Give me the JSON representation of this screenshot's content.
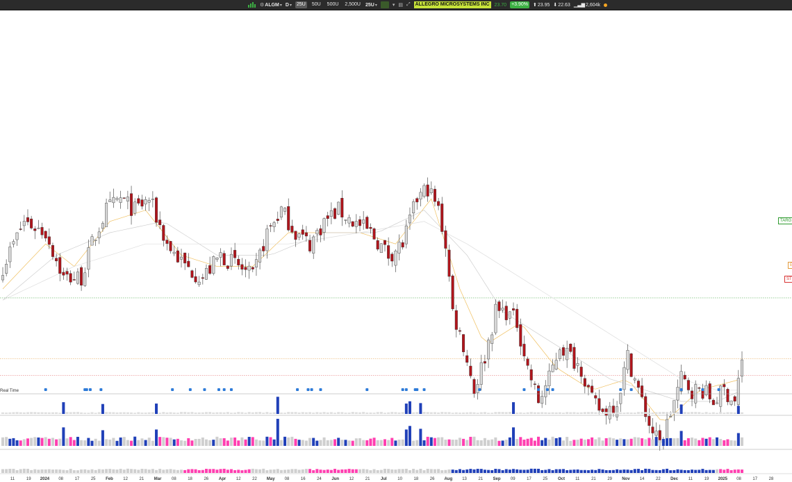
{
  "toolbar": {
    "symbol": "ALGM",
    "interval": "D",
    "bar_options": [
      "25U",
      "50U",
      "500U",
      "2,500U"
    ],
    "bar_selected": "25U",
    "bar_menu": "25U",
    "company": "ALLEGRO MICROSYSTEMS INC",
    "price": "23.70",
    "change": "+3.90%",
    "high": "23.95",
    "low": "22.63",
    "volume": "2,604k"
  },
  "labels": {
    "realtime": "Real Time",
    "target": "TARG",
    "entry": "E",
    "stop": "ST"
  },
  "colors": {
    "up_candle": "#d8d8d8",
    "down_candle": "#b0151c",
    "volume_blue": "#2040b8",
    "volume_pink": "#ff3fb0",
    "volume_gray": "#cfcfcf",
    "target_line": "#2e9a2e",
    "entry_line": "#e39a3b",
    "stop_line": "#d83333"
  },
  "chart_data": {
    "type": "candlestick",
    "price_levels": {
      "target": 29.2,
      "entry": 23.8,
      "stop": 22.3
    },
    "x_ticks": [
      "11",
      "19",
      "2024",
      "08",
      "17",
      "25",
      "Feb",
      "12",
      "21",
      "Mar",
      "08",
      "18",
      "26",
      "Apr",
      "12",
      "22",
      "May",
      "08",
      "16",
      "24",
      "Jun",
      "12",
      "21",
      "Jul",
      "10",
      "18",
      "26",
      "Aug",
      "13",
      "21",
      "Sep",
      "09",
      "17",
      "25",
      "Oct",
      "11",
      "21",
      "29",
      "Nov",
      "14",
      "22",
      "Dec",
      "11",
      "19",
      "2025",
      "08",
      "17",
      "28"
    ],
    "close_keyframes": [
      [
        0,
        32
      ],
      [
        6,
        36
      ],
      [
        12,
        35
      ],
      [
        17,
        31
      ],
      [
        22,
        31
      ],
      [
        25,
        34
      ],
      [
        29,
        37
      ],
      [
        33,
        38
      ],
      [
        37,
        37
      ],
      [
        41,
        38
      ],
      [
        46,
        34
      ],
      [
        51,
        32
      ],
      [
        56,
        31
      ],
      [
        61,
        33
      ],
      [
        66,
        32
      ],
      [
        70,
        31
      ],
      [
        74,
        35
      ],
      [
        78,
        37
      ],
      [
        82,
        35
      ],
      [
        86,
        34
      ],
      [
        90,
        36
      ],
      [
        94,
        37
      ],
      [
        98,
        36
      ],
      [
        103,
        35
      ],
      [
        108,
        33
      ],
      [
        112,
        34
      ],
      [
        116,
        38
      ],
      [
        119,
        39
      ],
      [
        122,
        37
      ],
      [
        124,
        34
      ],
      [
        126,
        28
      ],
      [
        129,
        25
      ],
      [
        132,
        21
      ],
      [
        135,
        24
      ],
      [
        138,
        28
      ],
      [
        141,
        28
      ],
      [
        144,
        27
      ],
      [
        147,
        23
      ],
      [
        150,
        20
      ],
      [
        153,
        22
      ],
      [
        156,
        25
      ],
      [
        159,
        24
      ],
      [
        162,
        23
      ],
      [
        165,
        20
      ],
      [
        168,
        19
      ],
      [
        172,
        20
      ],
      [
        175,
        24
      ],
      [
        178,
        21
      ],
      [
        181,
        18
      ],
      [
        184,
        16
      ],
      [
        187,
        19
      ],
      [
        190,
        22
      ],
      [
        193,
        21
      ],
      [
        196,
        21
      ],
      [
        199,
        20
      ],
      [
        202,
        21
      ],
      [
        205,
        20
      ],
      [
        207,
        23.7
      ]
    ],
    "ma_series": [
      {
        "period": 10,
        "color": "#f0c060",
        "points": [
          [
            0,
            30
          ],
          [
            12,
            34
          ],
          [
            20,
            32
          ],
          [
            30,
            36
          ],
          [
            40,
            37
          ],
          [
            50,
            33
          ],
          [
            60,
            32
          ],
          [
            70,
            32
          ],
          [
            80,
            35
          ],
          [
            90,
            35
          ],
          [
            100,
            35
          ],
          [
            110,
            34
          ],
          [
            120,
            38
          ],
          [
            128,
            30
          ],
          [
            135,
            25
          ],
          [
            145,
            27
          ],
          [
            155,
            23
          ],
          [
            165,
            21
          ],
          [
            175,
            22
          ],
          [
            185,
            18
          ],
          [
            195,
            21
          ],
          [
            207,
            22
          ]
        ]
      },
      {
        "period": 20,
        "color": "#cfcfcf",
        "points": [
          [
            0,
            29
          ],
          [
            15,
            33
          ],
          [
            30,
            35
          ],
          [
            45,
            36
          ],
          [
            60,
            33
          ],
          [
            75,
            33
          ],
          [
            90,
            35
          ],
          [
            105,
            35
          ],
          [
            118,
            37
          ],
          [
            130,
            33
          ],
          [
            140,
            28
          ],
          [
            150,
            26
          ],
          [
            160,
            24
          ],
          [
            170,
            22
          ],
          [
            180,
            21
          ],
          [
            190,
            20
          ],
          [
            200,
            20
          ],
          [
            207,
            21
          ]
        ]
      },
      {
        "period": 50,
        "color": "#dddddd",
        "points": [
          [
            0,
            29
          ],
          [
            20,
            32
          ],
          [
            40,
            34
          ],
          [
            60,
            34
          ],
          [
            80,
            34
          ],
          [
            100,
            35
          ],
          [
            118,
            36
          ],
          [
            130,
            34
          ],
          [
            140,
            32
          ],
          [
            150,
            30
          ],
          [
            160,
            28
          ],
          [
            170,
            26
          ],
          [
            180,
            24
          ],
          [
            190,
            22
          ],
          [
            200,
            21
          ],
          [
            207,
            21
          ]
        ]
      }
    ],
    "volume_spikes": [
      [
        17,
        2.6
      ],
      [
        28,
        2.2
      ],
      [
        43,
        2.3
      ],
      [
        77,
        3.8
      ],
      [
        113,
        2.3
      ],
      [
        114,
        2.8
      ],
      [
        117,
        2.4
      ],
      [
        143,
        2.6
      ],
      [
        190,
        2.1
      ],
      [
        206,
        1.8
      ]
    ]
  }
}
